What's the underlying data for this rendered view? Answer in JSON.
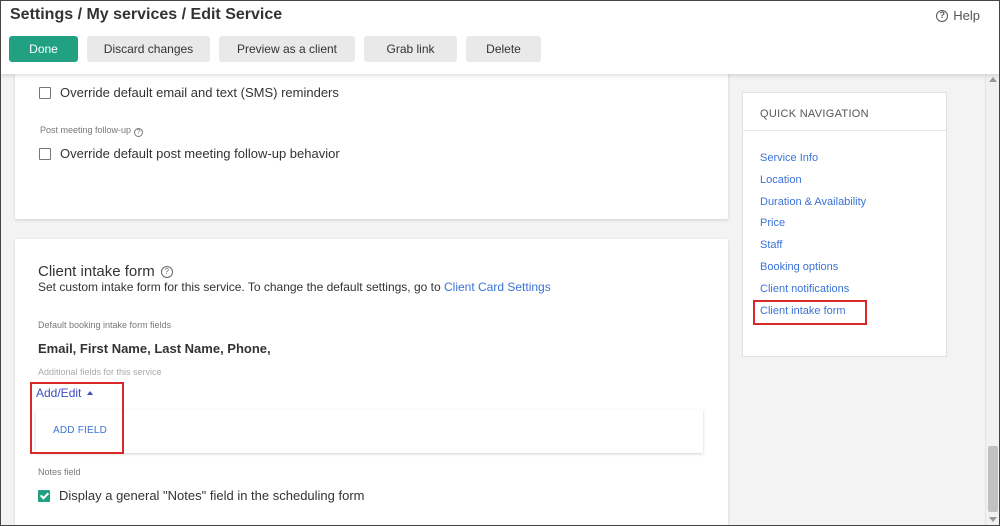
{
  "header": {
    "breadcrumb": "Settings / My services / Edit Service",
    "help_label": "Help",
    "buttons": {
      "done": "Done",
      "discard": "Discard changes",
      "preview": "Preview as a client",
      "grab": "Grab link",
      "delete": "Delete"
    }
  },
  "notifications_card": {
    "reminders_label": "Override default email and text (SMS) reminders",
    "reminders_checked": false,
    "followup_section_label": "Post meeting follow-up",
    "followup_label": "Override default post meeting follow-up behavior",
    "followup_checked": false
  },
  "intake_card": {
    "title": "Client intake form",
    "description": "Set custom intake form for this service. To change the default settings, go to ",
    "description_link": "Client Card Settings",
    "default_fields_label": "Default booking intake form fields",
    "default_fields_value": "Email, First Name, Last Name, Phone,",
    "additional_fields_label": "Additional fields for this service",
    "add_edit_label": "Add/Edit",
    "add_field_button": "ADD FIELD",
    "notes_section_label": "Notes field",
    "notes_label": "Display a general \"Notes\" field in the scheduling form",
    "notes_checked": true
  },
  "quick_navigation": {
    "title": "QUICK NAVIGATION",
    "items": [
      "Service Info",
      "Location",
      "Duration & Availability",
      "Price",
      "Staff",
      "Booking options",
      "Client notifications",
      "Client intake form"
    ]
  },
  "colors": {
    "accent": "#21a182",
    "link": "#3b73d6",
    "highlight": "#d82828"
  }
}
